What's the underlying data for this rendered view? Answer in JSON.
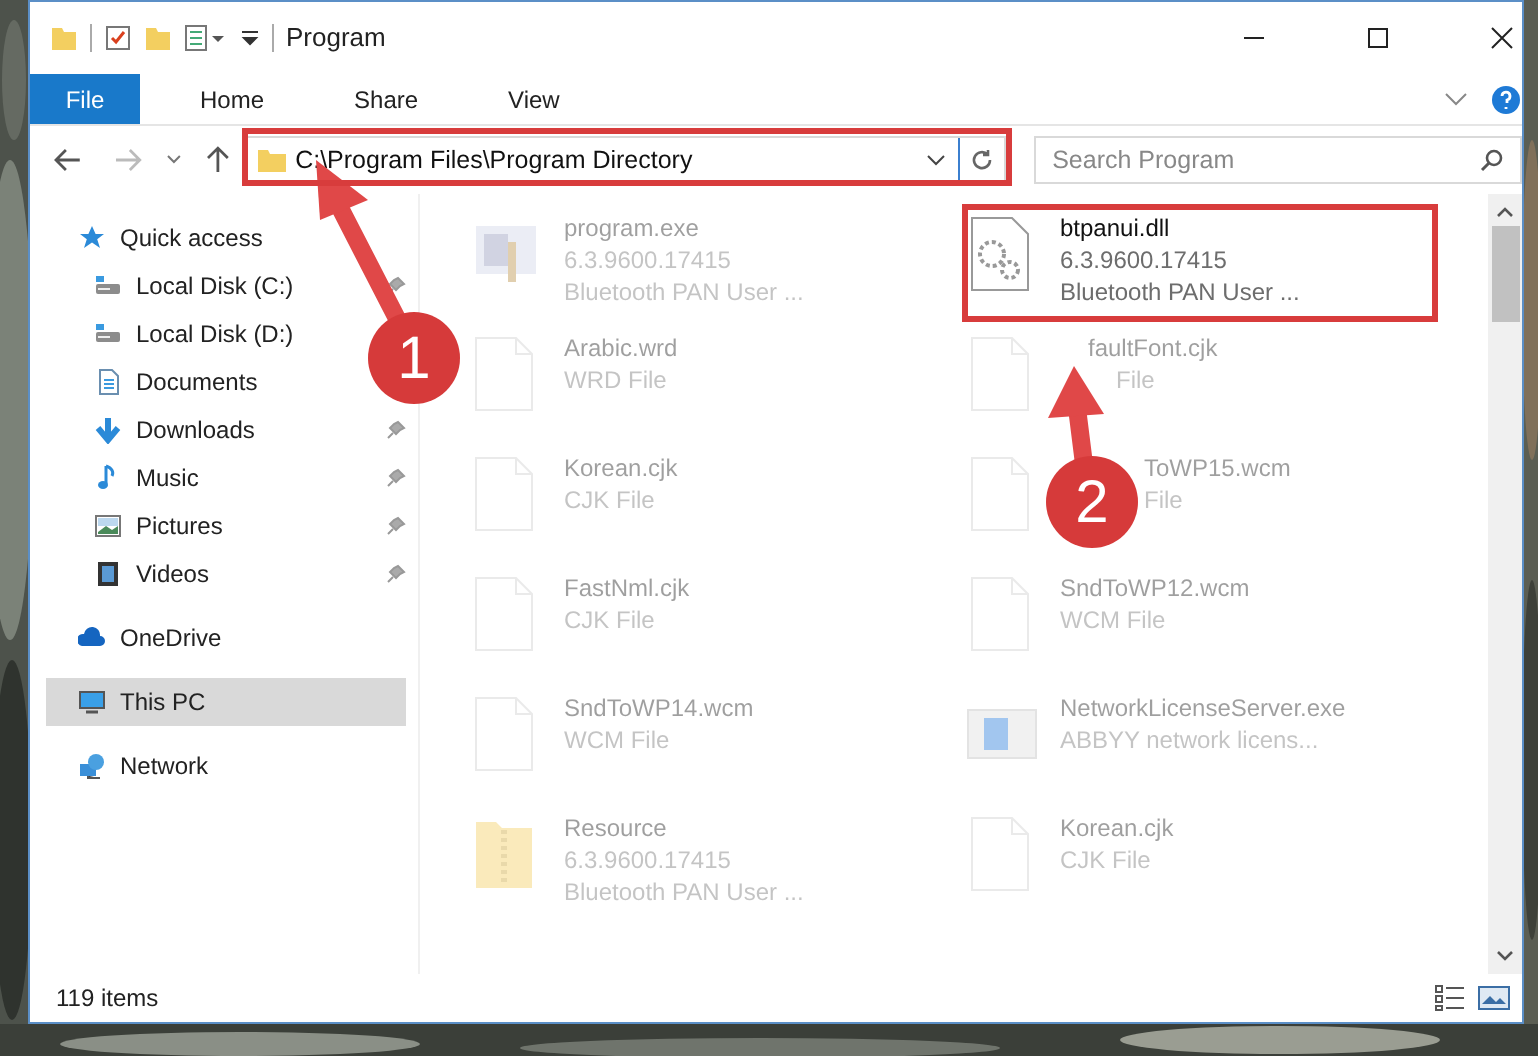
{
  "window": {
    "title": "Program"
  },
  "ribbon": {
    "tabs": [
      {
        "label": "File",
        "selected": true
      },
      {
        "label": "Home",
        "selected": false
      },
      {
        "label": "Share",
        "selected": false
      },
      {
        "label": "View",
        "selected": false
      }
    ]
  },
  "address_bar": {
    "path": "C:\\Program Files\\Program Directory"
  },
  "search": {
    "placeholder": "Search Program"
  },
  "sidebar": {
    "items": [
      {
        "label": "Quick access",
        "kind": "star",
        "selected": false,
        "children": [
          {
            "label": "Local Disk (C:)",
            "kind": "drive",
            "pinned": true
          },
          {
            "label": "Local Disk (D:)",
            "kind": "drive",
            "pinned": false
          },
          {
            "label": "Documents",
            "kind": "documents",
            "pinned": false
          },
          {
            "label": "Downloads",
            "kind": "downloads",
            "pinned": true
          },
          {
            "label": "Music",
            "kind": "music",
            "pinned": true
          },
          {
            "label": "Pictures",
            "kind": "pictures",
            "pinned": true
          },
          {
            "label": "Videos",
            "kind": "videos",
            "pinned": true
          }
        ]
      },
      {
        "label": "OneDrive",
        "kind": "cloud",
        "selected": false
      },
      {
        "label": "This PC",
        "kind": "pc",
        "selected": true
      },
      {
        "label": "Network",
        "kind": "network",
        "selected": false
      }
    ]
  },
  "files": [
    {
      "name": "program.exe",
      "details": [
        "6.3.9600.17415",
        "Bluetooth PAN User ..."
      ],
      "kind": "exe",
      "faded": true
    },
    {
      "name": "btpanui.dll",
      "details": [
        "6.3.9600.17415",
        "Bluetooth PAN User ..."
      ],
      "kind": "dll",
      "faded": false
    },
    {
      "name": "Arabic.wrd",
      "details": [
        "WRD File"
      ],
      "kind": "file",
      "faded": true
    },
    {
      "name": "faultFont.cjk",
      "details": [
        "File"
      ],
      "kind": "file",
      "faded": true
    },
    {
      "name": "Korean.cjk",
      "details": [
        "CJK File"
      ],
      "kind": "file",
      "faded": true
    },
    {
      "name": "ToWP15.wcm",
      "details": [
        "File"
      ],
      "kind": "file",
      "faded": true
    },
    {
      "name": "FastNml.cjk",
      "details": [
        "CJK File"
      ],
      "kind": "file",
      "faded": true
    },
    {
      "name": "SndToWP12.wcm",
      "details": [
        "WCM File"
      ],
      "kind": "file",
      "faded": true
    },
    {
      "name": "SndToWP14.wcm",
      "details": [
        "WCM File"
      ],
      "kind": "file",
      "faded": true
    },
    {
      "name": "NetworkLicenseServer.exe",
      "details": [
        "ABBYY network licens..."
      ],
      "kind": "app",
      "faded": true
    },
    {
      "name": "Resource",
      "details": [
        "6.3.9600.17415",
        "Bluetooth PAN User ..."
      ],
      "kind": "zip",
      "faded": true
    },
    {
      "name": "Korean.cjk",
      "details": [
        "CJK File"
      ],
      "kind": "file",
      "faded": true
    }
  ],
  "status_bar": {
    "item_count": "119 items"
  },
  "annotations": [
    {
      "number": "1"
    },
    {
      "number": "2"
    }
  ]
}
